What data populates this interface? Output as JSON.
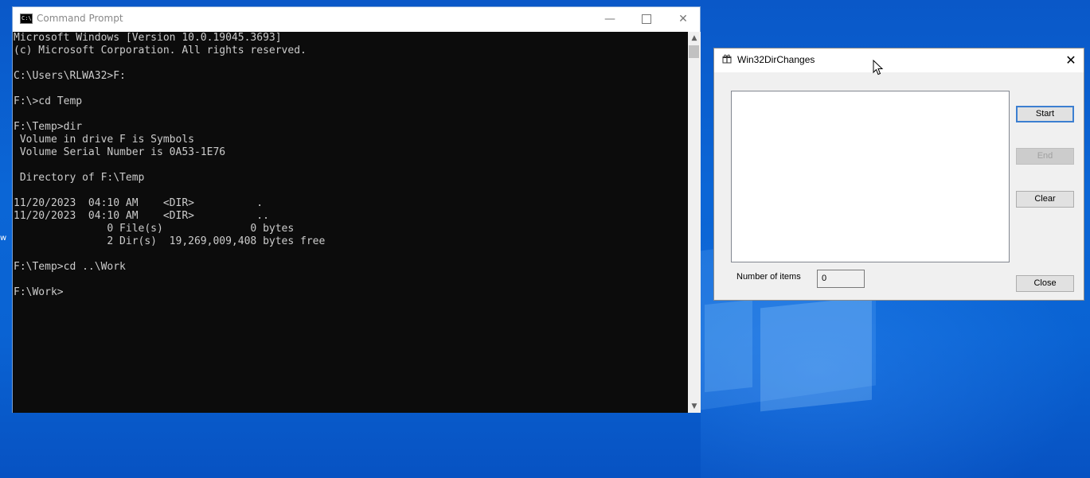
{
  "cmd": {
    "title": "Command Prompt",
    "icon_label": "C:\\",
    "lines": [
      "Microsoft Windows [Version 10.0.19045.3693]",
      "(c) Microsoft Corporation. All rights reserved.",
      "",
      "C:\\Users\\RLWA32>F:",
      "",
      "F:\\>cd Temp",
      "",
      "F:\\Temp>dir",
      " Volume in drive F is Symbols",
      " Volume Serial Number is 0A53-1E76",
      "",
      " Directory of F:\\Temp",
      "",
      "11/20/2023  04:10 AM    <DIR>          .",
      "11/20/2023  04:10 AM    <DIR>          ..",
      "               0 File(s)              0 bytes",
      "               2 Dir(s)  19,269,009,408 bytes free",
      "",
      "F:\\Temp>cd ..\\Work",
      "",
      "F:\\Work>"
    ],
    "minimize_glyph": "—",
    "close_glyph": "✕"
  },
  "dialog": {
    "title": "Win32DirChanges",
    "close_glyph": "✕",
    "buttons": {
      "start": "Start",
      "end": "End",
      "clear": "Clear",
      "close": "Close"
    },
    "items_label": "Number of items",
    "items_value": "0"
  },
  "desktop": {
    "edge_fragment": "w"
  },
  "colors": {
    "console_bg": "#0c0c0c",
    "console_fg": "#cccccc",
    "desktop": "#0a5fd0",
    "default_button_border": "#3c7fd1"
  }
}
